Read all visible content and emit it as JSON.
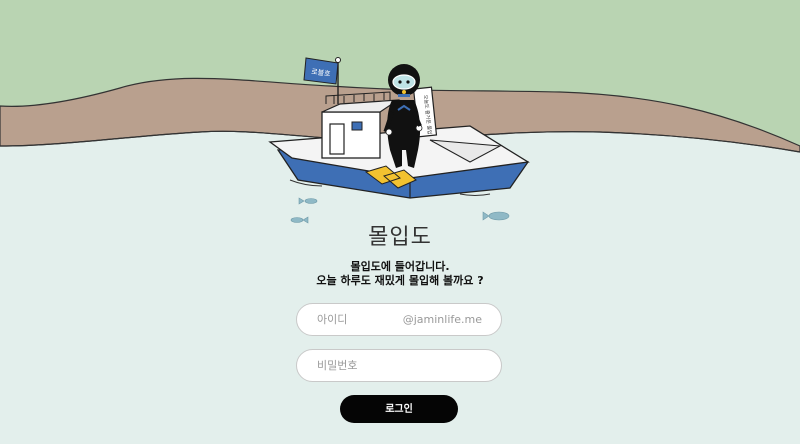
{
  "app": {
    "title": "몰입도",
    "flag_label": "로블호",
    "sign_text": "오늘도 즐거운 몰입"
  },
  "intro": {
    "line1": "몰입도에 들어갑니다.",
    "line2": "오늘 하루도 재밌게 몰입해 볼까요 ?"
  },
  "form": {
    "id_placeholder": "아이디",
    "id_value": "",
    "domain": "@jaminlife.me",
    "password_placeholder": "비밀번호",
    "password_value": "",
    "login_label": "로그인"
  },
  "colors": {
    "land_green": "#b9d4b2",
    "shore_brown": "#b9a08e",
    "water": "#e3efec",
    "boat_blue": "#3e6fb5",
    "fins_yellow": "#f2c230",
    "button": "#050505"
  }
}
